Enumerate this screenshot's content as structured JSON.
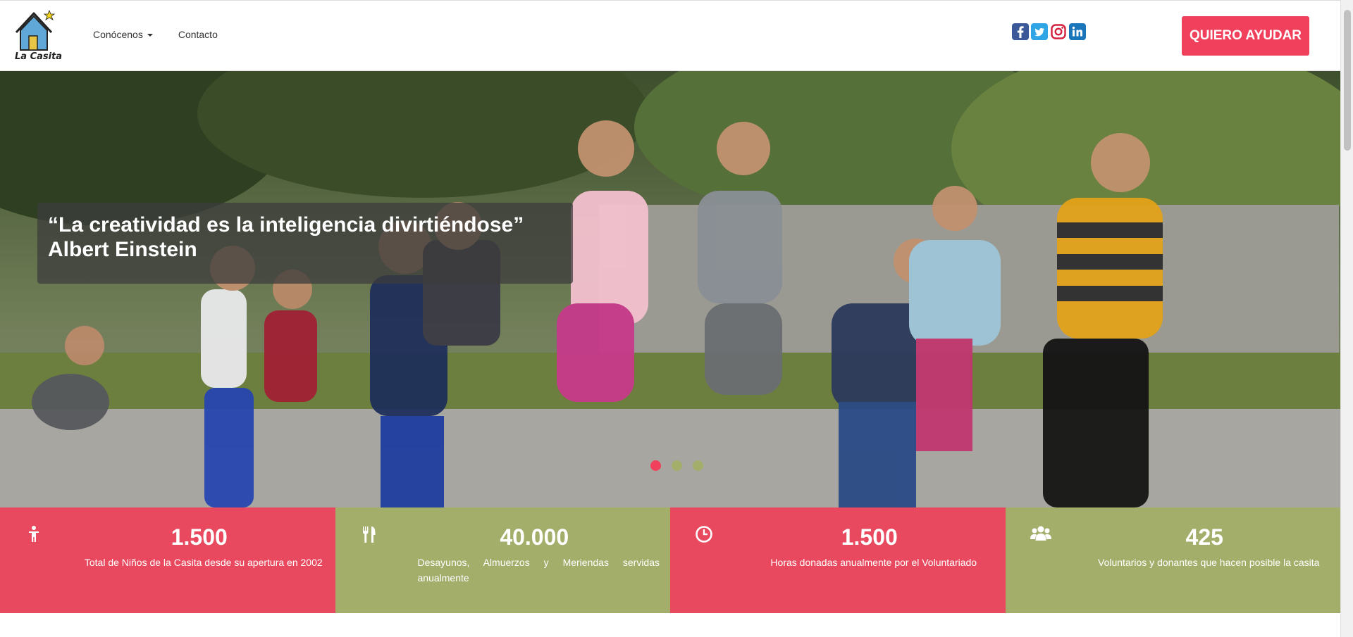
{
  "brand": {
    "name": "La Casita"
  },
  "nav": {
    "items": [
      {
        "label": "Conócenos",
        "dropdown": true
      },
      {
        "label": "Contacto",
        "dropdown": false
      }
    ],
    "social": [
      "facebook-icon",
      "twitter-icon",
      "instagram-icon",
      "linkedin-icon"
    ],
    "cta_label": "QUIERO AYUDAR"
  },
  "hero": {
    "quote_line1": "“La creatividad es la inteligencia divirtiéndose”",
    "quote_line2": "Albert Einstein",
    "slides": 3,
    "active_slide": 1
  },
  "stats": [
    {
      "icon": "child-icon",
      "value": "1.500",
      "label": "Total de Niños de la Casita desde su apertura en 2002",
      "color": "#e8495f"
    },
    {
      "icon": "cutlery-icon",
      "value": "40.000",
      "label": "Desayunos, Almuerzos y Meriendas servidas anualmente",
      "color": "#a3ae6b"
    },
    {
      "icon": "clock-icon",
      "value": "1.500",
      "label": "Horas donadas anualmente por el Voluntariado",
      "color": "#e8495f"
    },
    {
      "icon": "users-icon",
      "value": "425",
      "label": "Voluntarios y donantes que hacen posible la casita",
      "color": "#a3ae6b"
    }
  ],
  "colors": {
    "accent": "#f0405c",
    "green": "#a3ae6b",
    "red": "#e8495f"
  }
}
